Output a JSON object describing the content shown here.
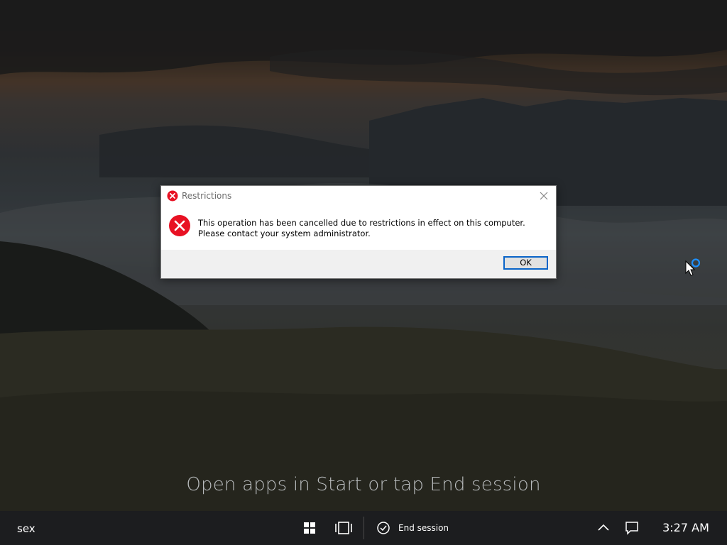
{
  "dialog": {
    "title": "Restrictions",
    "message": "This operation has been cancelled due to restrictions in effect on this computer. Please contact your system administrator.",
    "ok_label": "OK",
    "icons": {
      "title": "error-icon",
      "message": "error-icon",
      "close": "close-icon"
    }
  },
  "desktop": {
    "hint": "Open apps in Start or tap End session"
  },
  "taskbar": {
    "user": "sex",
    "end_session_label": "End session",
    "time": "3:27 AM",
    "icons": [
      "windows-logo-icon",
      "task-view-icon",
      "checkmark-circle-icon",
      "chevron-up-icon",
      "action-center-icon"
    ]
  },
  "colors": {
    "error": "#e81123",
    "ok_border": "#0a64c8",
    "taskbar": "#1c1d1f",
    "busy_ring": "#1e90ff"
  }
}
